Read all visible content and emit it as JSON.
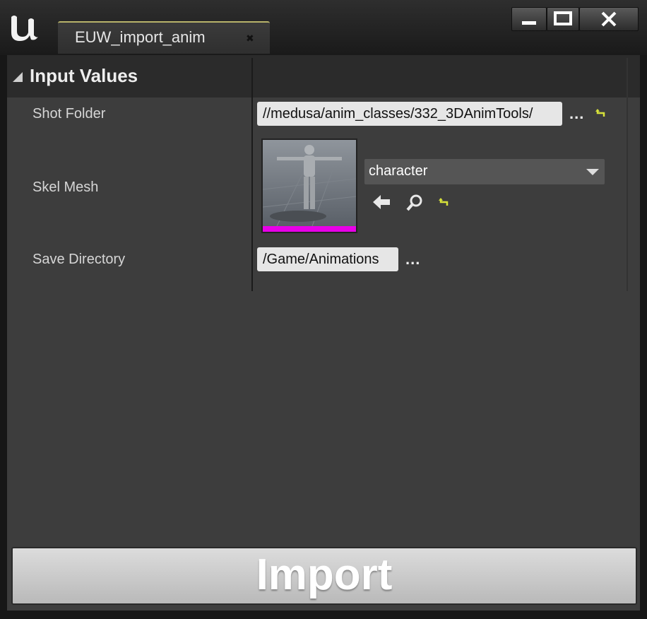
{
  "window": {
    "tab_title": "EUW_import_anim",
    "tab_close_glyph": "✖",
    "minimize_icon": "minimize-icon",
    "maximize_icon": "maximize-icon",
    "close_icon": "close-icon",
    "logo_icon": "unreal-logo-icon"
  },
  "section": {
    "title": "Input Values"
  },
  "fields": {
    "shot_folder": {
      "label": "Shot Folder",
      "value": "//medusa/anim_classes/332_3DAnimTools/"
    },
    "skel_mesh": {
      "label": "Skel Mesh",
      "selected": "character",
      "thumbnail_icon": "character-mannequin-icon",
      "thumbnail_bar_color": "#e800e8"
    },
    "save_directory": {
      "label": "Save Directory",
      "value": "/Game/Animations"
    }
  },
  "browse_dots": "...",
  "import_button": {
    "label": "Import"
  },
  "colors": {
    "panel": "#3d3d3d",
    "header": "#2b2b2b",
    "tab_accent": "#b8b36a",
    "reset_arrow": "#d7e23a"
  }
}
